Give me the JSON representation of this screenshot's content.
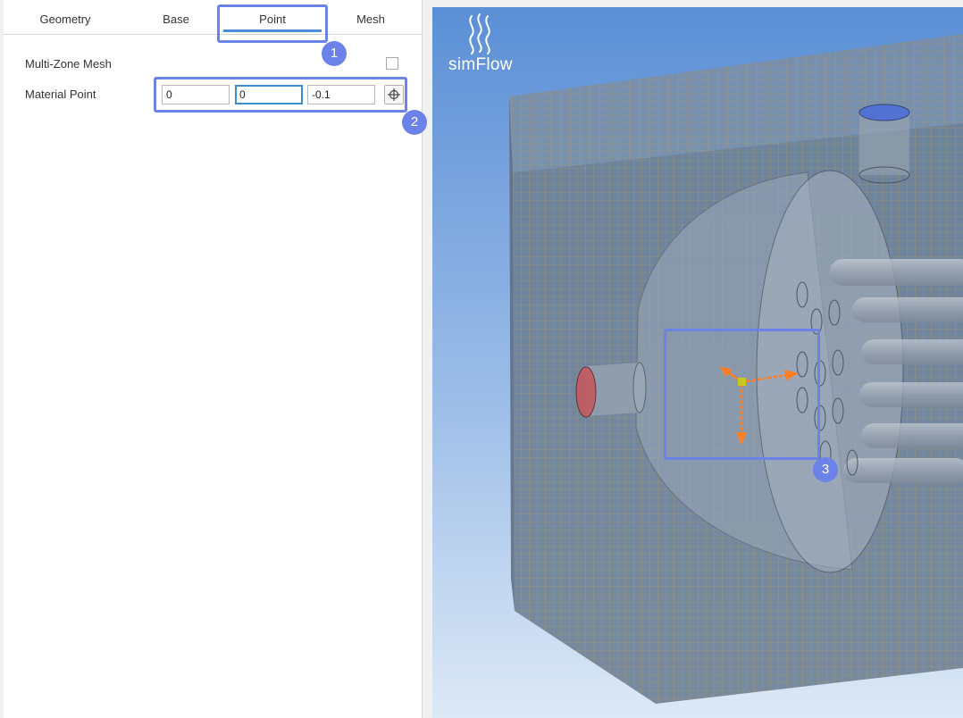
{
  "tabs": [
    {
      "label": "Geometry"
    },
    {
      "label": "Base"
    },
    {
      "label": "Point"
    },
    {
      "label": "Mesh"
    }
  ],
  "active_tab": "Point",
  "form": {
    "multizone_label": "Multi-Zone Mesh",
    "multizone_checked": false,
    "material_point_label": "Material Point",
    "material_point_values": [
      "0",
      "0",
      "-0.1"
    ]
  },
  "annotations": [
    {
      "label": "1"
    },
    {
      "label": "2"
    },
    {
      "label": "3"
    }
  ],
  "viewport": {
    "logo_text": "simFlow"
  },
  "colors": {
    "accent": "#6b82e8",
    "tab_underline": "#4a90d9",
    "gizmo": "#ff7f27",
    "point_marker": "#c8c820",
    "mesh_lines": "#c9a24a"
  },
  "icons": {
    "pick_point": "crosshair-icon",
    "logo": "steam-waves-icon"
  }
}
